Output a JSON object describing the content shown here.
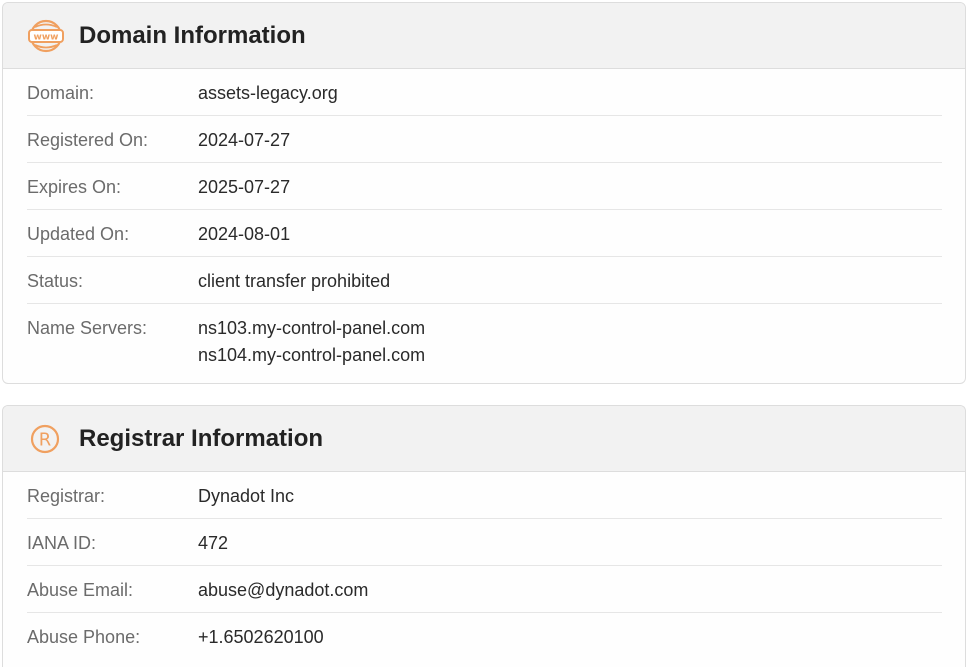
{
  "domain_info": {
    "title": "Domain Information",
    "icon": "www-globe-icon",
    "accent_color": "#f0a060",
    "rows": [
      {
        "label": "Domain:",
        "value": "assets-legacy.org"
      },
      {
        "label": "Registered On:",
        "value": "2024-07-27"
      },
      {
        "label": "Expires On:",
        "value": "2025-07-27"
      },
      {
        "label": "Updated On:",
        "value": "2024-08-01"
      },
      {
        "label": "Status:",
        "value": "client transfer prohibited"
      }
    ],
    "name_servers": {
      "label": "Name Servers:",
      "values": [
        "ns103.my-control-panel.com",
        "ns104.my-control-panel.com"
      ]
    }
  },
  "registrar_info": {
    "title": "Registrar Information",
    "icon": "registered-trademark-icon",
    "rows": [
      {
        "label": "Registrar:",
        "value": "Dynadot Inc"
      },
      {
        "label": "IANA ID:",
        "value": "472"
      },
      {
        "label": "Abuse Email:",
        "value": "abuse@dynadot.com"
      },
      {
        "label": "Abuse Phone:",
        "value": "+1.6502620100"
      }
    ]
  }
}
